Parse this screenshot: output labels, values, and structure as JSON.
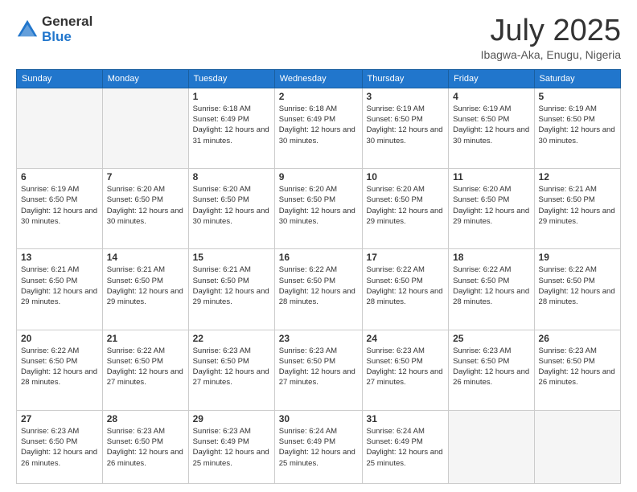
{
  "logo": {
    "general": "General",
    "blue": "Blue"
  },
  "title": "July 2025",
  "location": "Ibagwa-Aka, Enugu, Nigeria",
  "days_of_week": [
    "Sunday",
    "Monday",
    "Tuesday",
    "Wednesday",
    "Thursday",
    "Friday",
    "Saturday"
  ],
  "weeks": [
    [
      {
        "day": "",
        "info": ""
      },
      {
        "day": "",
        "info": ""
      },
      {
        "day": "1",
        "info": "Sunrise: 6:18 AM\nSunset: 6:49 PM\nDaylight: 12 hours and 31 minutes."
      },
      {
        "day": "2",
        "info": "Sunrise: 6:18 AM\nSunset: 6:49 PM\nDaylight: 12 hours and 30 minutes."
      },
      {
        "day": "3",
        "info": "Sunrise: 6:19 AM\nSunset: 6:50 PM\nDaylight: 12 hours and 30 minutes."
      },
      {
        "day": "4",
        "info": "Sunrise: 6:19 AM\nSunset: 6:50 PM\nDaylight: 12 hours and 30 minutes."
      },
      {
        "day": "5",
        "info": "Sunrise: 6:19 AM\nSunset: 6:50 PM\nDaylight: 12 hours and 30 minutes."
      }
    ],
    [
      {
        "day": "6",
        "info": "Sunrise: 6:19 AM\nSunset: 6:50 PM\nDaylight: 12 hours and 30 minutes."
      },
      {
        "day": "7",
        "info": "Sunrise: 6:20 AM\nSunset: 6:50 PM\nDaylight: 12 hours and 30 minutes."
      },
      {
        "day": "8",
        "info": "Sunrise: 6:20 AM\nSunset: 6:50 PM\nDaylight: 12 hours and 30 minutes."
      },
      {
        "day": "9",
        "info": "Sunrise: 6:20 AM\nSunset: 6:50 PM\nDaylight: 12 hours and 30 minutes."
      },
      {
        "day": "10",
        "info": "Sunrise: 6:20 AM\nSunset: 6:50 PM\nDaylight: 12 hours and 29 minutes."
      },
      {
        "day": "11",
        "info": "Sunrise: 6:20 AM\nSunset: 6:50 PM\nDaylight: 12 hours and 29 minutes."
      },
      {
        "day": "12",
        "info": "Sunrise: 6:21 AM\nSunset: 6:50 PM\nDaylight: 12 hours and 29 minutes."
      }
    ],
    [
      {
        "day": "13",
        "info": "Sunrise: 6:21 AM\nSunset: 6:50 PM\nDaylight: 12 hours and 29 minutes."
      },
      {
        "day": "14",
        "info": "Sunrise: 6:21 AM\nSunset: 6:50 PM\nDaylight: 12 hours and 29 minutes."
      },
      {
        "day": "15",
        "info": "Sunrise: 6:21 AM\nSunset: 6:50 PM\nDaylight: 12 hours and 29 minutes."
      },
      {
        "day": "16",
        "info": "Sunrise: 6:22 AM\nSunset: 6:50 PM\nDaylight: 12 hours and 28 minutes."
      },
      {
        "day": "17",
        "info": "Sunrise: 6:22 AM\nSunset: 6:50 PM\nDaylight: 12 hours and 28 minutes."
      },
      {
        "day": "18",
        "info": "Sunrise: 6:22 AM\nSunset: 6:50 PM\nDaylight: 12 hours and 28 minutes."
      },
      {
        "day": "19",
        "info": "Sunrise: 6:22 AM\nSunset: 6:50 PM\nDaylight: 12 hours and 28 minutes."
      }
    ],
    [
      {
        "day": "20",
        "info": "Sunrise: 6:22 AM\nSunset: 6:50 PM\nDaylight: 12 hours and 28 minutes."
      },
      {
        "day": "21",
        "info": "Sunrise: 6:22 AM\nSunset: 6:50 PM\nDaylight: 12 hours and 27 minutes."
      },
      {
        "day": "22",
        "info": "Sunrise: 6:23 AM\nSunset: 6:50 PM\nDaylight: 12 hours and 27 minutes."
      },
      {
        "day": "23",
        "info": "Sunrise: 6:23 AM\nSunset: 6:50 PM\nDaylight: 12 hours and 27 minutes."
      },
      {
        "day": "24",
        "info": "Sunrise: 6:23 AM\nSunset: 6:50 PM\nDaylight: 12 hours and 27 minutes."
      },
      {
        "day": "25",
        "info": "Sunrise: 6:23 AM\nSunset: 6:50 PM\nDaylight: 12 hours and 26 minutes."
      },
      {
        "day": "26",
        "info": "Sunrise: 6:23 AM\nSunset: 6:50 PM\nDaylight: 12 hours and 26 minutes."
      }
    ],
    [
      {
        "day": "27",
        "info": "Sunrise: 6:23 AM\nSunset: 6:50 PM\nDaylight: 12 hours and 26 minutes."
      },
      {
        "day": "28",
        "info": "Sunrise: 6:23 AM\nSunset: 6:50 PM\nDaylight: 12 hours and 26 minutes."
      },
      {
        "day": "29",
        "info": "Sunrise: 6:23 AM\nSunset: 6:49 PM\nDaylight: 12 hours and 25 minutes."
      },
      {
        "day": "30",
        "info": "Sunrise: 6:24 AM\nSunset: 6:49 PM\nDaylight: 12 hours and 25 minutes."
      },
      {
        "day": "31",
        "info": "Sunrise: 6:24 AM\nSunset: 6:49 PM\nDaylight: 12 hours and 25 minutes."
      },
      {
        "day": "",
        "info": ""
      },
      {
        "day": "",
        "info": ""
      }
    ]
  ]
}
